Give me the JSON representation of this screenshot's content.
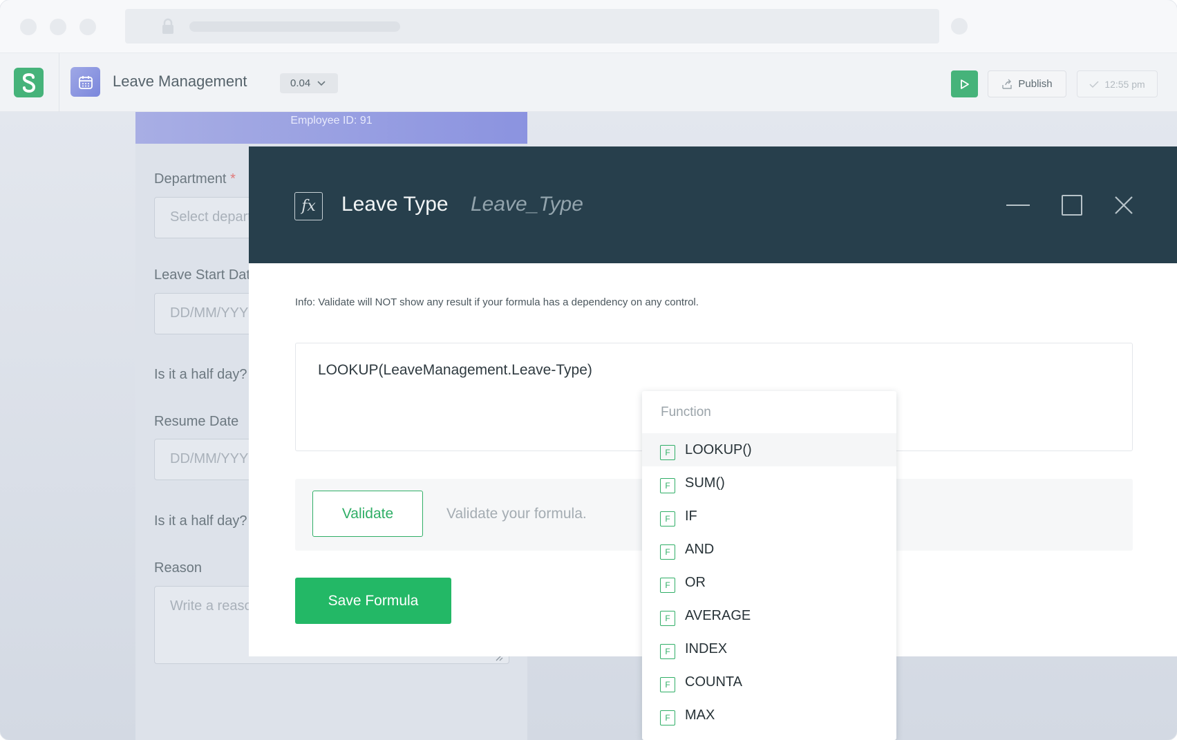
{
  "app": {
    "title": "Leave Management",
    "version": "0.04",
    "publish_label": "Publish",
    "saved_time": "12:55 pm",
    "brand_color": "#46b37a"
  },
  "form": {
    "banner_text": "Employee ID: 91",
    "fields": [
      {
        "label": "Department",
        "required_mark": "*",
        "placeholder": "Select department"
      },
      {
        "label": "Leave Start Date",
        "placeholder": "DD/MM/YYYY"
      },
      {
        "label": "Is it a half day?"
      },
      {
        "label": "Resume Date",
        "placeholder": "DD/MM/YYYY"
      },
      {
        "label": "Is it a half day?"
      },
      {
        "label": "Reason",
        "placeholder": "Write a reason"
      }
    ]
  },
  "modal": {
    "title": "Leave Type",
    "subtitle": "Leave_Type",
    "fx_symbol": "fx",
    "info": "Info: Validate will NOT show any result if your formula has a dependency on any control.",
    "formula": "LOOKUP(LeaveManagement.Leave-Type)",
    "validate_label": "Validate",
    "validate_hint": "Validate your formula.",
    "save_label": "Save Formula",
    "header_color": "#273f4c",
    "accent_color": "#23b866"
  },
  "function_dropdown": {
    "header": "Function",
    "badge": "F",
    "items": [
      "LOOKUP()",
      "SUM()",
      "IF",
      "AND",
      "OR",
      "AVERAGE",
      "INDEX",
      "COUNTA",
      "MAX"
    ],
    "highlighted": "LOOKUP()"
  },
  "icons": [
    "lock-icon",
    "brand-logo-icon",
    "calendar-icon",
    "chevron-down-icon",
    "play-icon",
    "share-icon",
    "check-icon",
    "fx-icon",
    "minimize-icon",
    "maximize-icon",
    "close-icon",
    "resize-handle-icon"
  ]
}
